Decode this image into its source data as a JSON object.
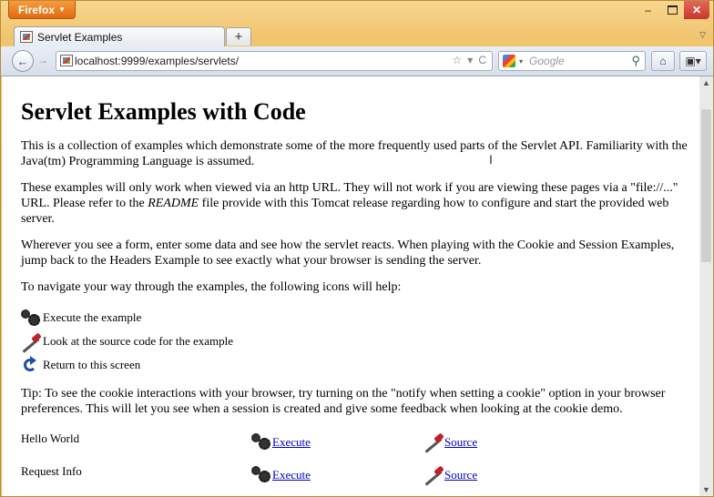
{
  "browser": {
    "app_menu_label": "Firefox",
    "tab_title": "Servlet Examples",
    "url": "localhost:9999/examples/servlets/",
    "search_placeholder": "Google"
  },
  "page": {
    "heading": "Servlet Examples with Code",
    "intro": "This is a collection of examples which demonstrate some of the more frequently used parts of the Servlet API. Familiarity with the Java(tm) Programming Language is assumed.",
    "http_note_before": "These examples will only work when viewed via an http URL. They will not work if you are viewing these pages via a \"file://...\" URL. Please refer to the ",
    "readme": "README",
    "http_note_after": " file provide with this Tomcat release regarding how to configure and start the provided web server.",
    "form_note": "Wherever you see a form, enter some data and see how the servlet reacts. When playing with the Cookie and Session Examples, jump back to the Headers Example to see exactly what your browser is sending the server.",
    "navigate_note": "To navigate your way through the examples, the following icons will help:",
    "legend": {
      "execute": "Execute the example",
      "source": "Look at the source code for the example",
      "return": "Return to this screen"
    },
    "tip": "Tip: To see the cookie interactions with your browser, try turning on the \"notify when setting a cookie\" option in your browser preferences. This will let you see when a session is created and give some feedback when looking at the cookie demo.",
    "examples": [
      {
        "name": "Hello World",
        "execute": "Execute",
        "source": "Source"
      },
      {
        "name": "Request Info",
        "execute": "Execute",
        "source": "Source"
      }
    ]
  }
}
